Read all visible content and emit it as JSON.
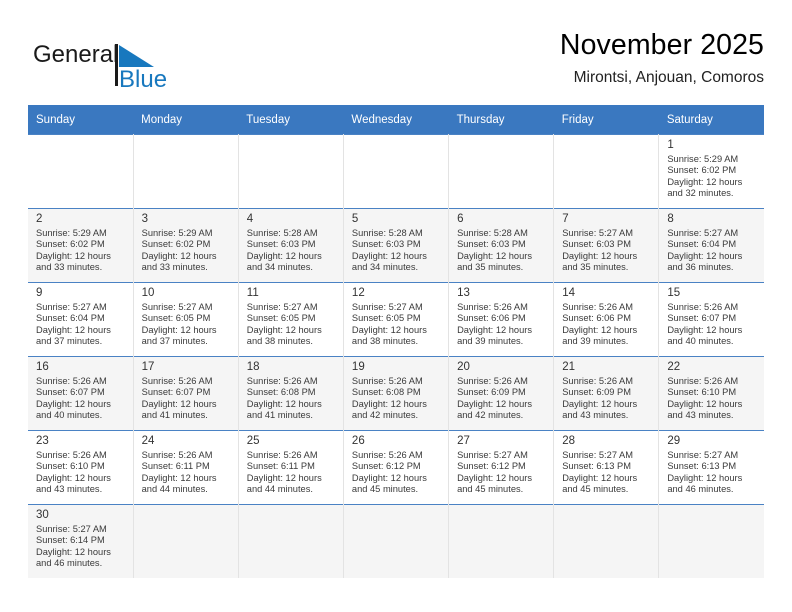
{
  "brand": {
    "name_part1": "General",
    "name_part2": "Blue",
    "logo_icon": "blue-triangle-flag-icon",
    "color_primary": "#1a1a1a",
    "color_accent": "#1878be"
  },
  "header": {
    "title": "November 2025",
    "subtitle": "Mirontsi, Anjouan, Comoros"
  },
  "theme": {
    "header_row_bg": "#3a78c0",
    "header_row_text": "#ffffff",
    "row_divider": "#4a82c4",
    "cell_alt_bg": "#f5f5f5"
  },
  "weekdays": [
    {
      "label": "Sunday"
    },
    {
      "label": "Monday"
    },
    {
      "label": "Tuesday"
    },
    {
      "label": "Wednesday"
    },
    {
      "label": "Thursday"
    },
    {
      "label": "Friday"
    },
    {
      "label": "Saturday"
    }
  ],
  "weeks": [
    {
      "shaded": false,
      "days": [
        {
          "empty": true
        },
        {
          "empty": true
        },
        {
          "empty": true
        },
        {
          "empty": true
        },
        {
          "empty": true
        },
        {
          "empty": true
        },
        {
          "empty": false,
          "day": "1",
          "sunrise": "Sunrise: 5:29 AM",
          "sunset": "Sunset: 6:02 PM",
          "daylight": "Daylight: 12 hours and 32 minutes."
        }
      ]
    },
    {
      "shaded": true,
      "days": [
        {
          "empty": false,
          "day": "2",
          "sunrise": "Sunrise: 5:29 AM",
          "sunset": "Sunset: 6:02 PM",
          "daylight": "Daylight: 12 hours and 33 minutes."
        },
        {
          "empty": false,
          "day": "3",
          "sunrise": "Sunrise: 5:29 AM",
          "sunset": "Sunset: 6:02 PM",
          "daylight": "Daylight: 12 hours and 33 minutes."
        },
        {
          "empty": false,
          "day": "4",
          "sunrise": "Sunrise: 5:28 AM",
          "sunset": "Sunset: 6:03 PM",
          "daylight": "Daylight: 12 hours and 34 minutes."
        },
        {
          "empty": false,
          "day": "5",
          "sunrise": "Sunrise: 5:28 AM",
          "sunset": "Sunset: 6:03 PM",
          "daylight": "Daylight: 12 hours and 34 minutes."
        },
        {
          "empty": false,
          "day": "6",
          "sunrise": "Sunrise: 5:28 AM",
          "sunset": "Sunset: 6:03 PM",
          "daylight": "Daylight: 12 hours and 35 minutes."
        },
        {
          "empty": false,
          "day": "7",
          "sunrise": "Sunrise: 5:27 AM",
          "sunset": "Sunset: 6:03 PM",
          "daylight": "Daylight: 12 hours and 35 minutes."
        },
        {
          "empty": false,
          "day": "8",
          "sunrise": "Sunrise: 5:27 AM",
          "sunset": "Sunset: 6:04 PM",
          "daylight": "Daylight: 12 hours and 36 minutes."
        }
      ]
    },
    {
      "shaded": false,
      "days": [
        {
          "empty": false,
          "day": "9",
          "sunrise": "Sunrise: 5:27 AM",
          "sunset": "Sunset: 6:04 PM",
          "daylight": "Daylight: 12 hours and 37 minutes."
        },
        {
          "empty": false,
          "day": "10",
          "sunrise": "Sunrise: 5:27 AM",
          "sunset": "Sunset: 6:05 PM",
          "daylight": "Daylight: 12 hours and 37 minutes."
        },
        {
          "empty": false,
          "day": "11",
          "sunrise": "Sunrise: 5:27 AM",
          "sunset": "Sunset: 6:05 PM",
          "daylight": "Daylight: 12 hours and 38 minutes."
        },
        {
          "empty": false,
          "day": "12",
          "sunrise": "Sunrise: 5:27 AM",
          "sunset": "Sunset: 6:05 PM",
          "daylight": "Daylight: 12 hours and 38 minutes."
        },
        {
          "empty": false,
          "day": "13",
          "sunrise": "Sunrise: 5:26 AM",
          "sunset": "Sunset: 6:06 PM",
          "daylight": "Daylight: 12 hours and 39 minutes."
        },
        {
          "empty": false,
          "day": "14",
          "sunrise": "Sunrise: 5:26 AM",
          "sunset": "Sunset: 6:06 PM",
          "daylight": "Daylight: 12 hours and 39 minutes."
        },
        {
          "empty": false,
          "day": "15",
          "sunrise": "Sunrise: 5:26 AM",
          "sunset": "Sunset: 6:07 PM",
          "daylight": "Daylight: 12 hours and 40 minutes."
        }
      ]
    },
    {
      "shaded": true,
      "days": [
        {
          "empty": false,
          "day": "16",
          "sunrise": "Sunrise: 5:26 AM",
          "sunset": "Sunset: 6:07 PM",
          "daylight": "Daylight: 12 hours and 40 minutes."
        },
        {
          "empty": false,
          "day": "17",
          "sunrise": "Sunrise: 5:26 AM",
          "sunset": "Sunset: 6:07 PM",
          "daylight": "Daylight: 12 hours and 41 minutes."
        },
        {
          "empty": false,
          "day": "18",
          "sunrise": "Sunrise: 5:26 AM",
          "sunset": "Sunset: 6:08 PM",
          "daylight": "Daylight: 12 hours and 41 minutes."
        },
        {
          "empty": false,
          "day": "19",
          "sunrise": "Sunrise: 5:26 AM",
          "sunset": "Sunset: 6:08 PM",
          "daylight": "Daylight: 12 hours and 42 minutes."
        },
        {
          "empty": false,
          "day": "20",
          "sunrise": "Sunrise: 5:26 AM",
          "sunset": "Sunset: 6:09 PM",
          "daylight": "Daylight: 12 hours and 42 minutes."
        },
        {
          "empty": false,
          "day": "21",
          "sunrise": "Sunrise: 5:26 AM",
          "sunset": "Sunset: 6:09 PM",
          "daylight": "Daylight: 12 hours and 43 minutes."
        },
        {
          "empty": false,
          "day": "22",
          "sunrise": "Sunrise: 5:26 AM",
          "sunset": "Sunset: 6:10 PM",
          "daylight": "Daylight: 12 hours and 43 minutes."
        }
      ]
    },
    {
      "shaded": false,
      "days": [
        {
          "empty": false,
          "day": "23",
          "sunrise": "Sunrise: 5:26 AM",
          "sunset": "Sunset: 6:10 PM",
          "daylight": "Daylight: 12 hours and 43 minutes."
        },
        {
          "empty": false,
          "day": "24",
          "sunrise": "Sunrise: 5:26 AM",
          "sunset": "Sunset: 6:11 PM",
          "daylight": "Daylight: 12 hours and 44 minutes."
        },
        {
          "empty": false,
          "day": "25",
          "sunrise": "Sunrise: 5:26 AM",
          "sunset": "Sunset: 6:11 PM",
          "daylight": "Daylight: 12 hours and 44 minutes."
        },
        {
          "empty": false,
          "day": "26",
          "sunrise": "Sunrise: 5:26 AM",
          "sunset": "Sunset: 6:12 PM",
          "daylight": "Daylight: 12 hours and 45 minutes."
        },
        {
          "empty": false,
          "day": "27",
          "sunrise": "Sunrise: 5:27 AM",
          "sunset": "Sunset: 6:12 PM",
          "daylight": "Daylight: 12 hours and 45 minutes."
        },
        {
          "empty": false,
          "day": "28",
          "sunrise": "Sunrise: 5:27 AM",
          "sunset": "Sunset: 6:13 PM",
          "daylight": "Daylight: 12 hours and 45 minutes."
        },
        {
          "empty": false,
          "day": "29",
          "sunrise": "Sunrise: 5:27 AM",
          "sunset": "Sunset: 6:13 PM",
          "daylight": "Daylight: 12 hours and 46 minutes."
        }
      ]
    },
    {
      "shaded": true,
      "days": [
        {
          "empty": false,
          "day": "30",
          "sunrise": "Sunrise: 5:27 AM",
          "sunset": "Sunset: 6:14 PM",
          "daylight": "Daylight: 12 hours and 46 minutes."
        },
        {
          "empty": true
        },
        {
          "empty": true
        },
        {
          "empty": true
        },
        {
          "empty": true
        },
        {
          "empty": true
        },
        {
          "empty": true
        }
      ]
    }
  ]
}
